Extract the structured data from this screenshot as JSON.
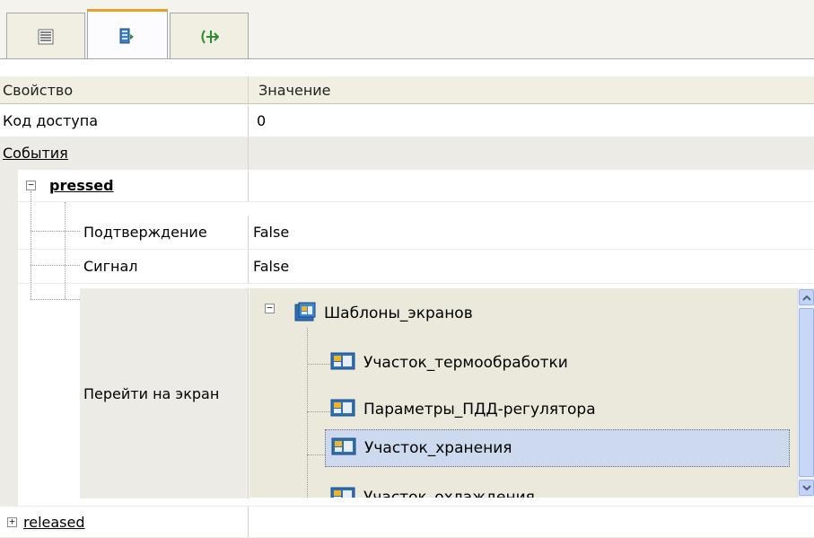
{
  "tabs": [
    {
      "icon": "list-view-icon",
      "active": false
    },
    {
      "icon": "properties-icon",
      "active": true
    },
    {
      "icon": "events-icon",
      "active": false
    }
  ],
  "header": {
    "property": "Свойство",
    "value": "Значение"
  },
  "rows": {
    "access_code": {
      "label": "Код доступа",
      "value": "0"
    },
    "events": {
      "label": "События"
    },
    "pressed": {
      "label": "pressed"
    },
    "confirm": {
      "label": "Подтверждение",
      "value": "False"
    },
    "signal": {
      "label": "Сигнал",
      "value": "False"
    },
    "goto_screen": {
      "label": "Перейти на экран"
    },
    "released": {
      "label": "released"
    }
  },
  "tree": {
    "root": "Шаблоны_экранов",
    "children": [
      "Участок_термообработки",
      "Параметры_ПДД-регулятора",
      "Участок_хранения",
      "Участок_охлаждения"
    ],
    "selected_index": 2
  },
  "colors": {
    "header_bg": "#f1efe2",
    "selection": "#cdd9ee",
    "tab_accent": "#e6a224"
  }
}
